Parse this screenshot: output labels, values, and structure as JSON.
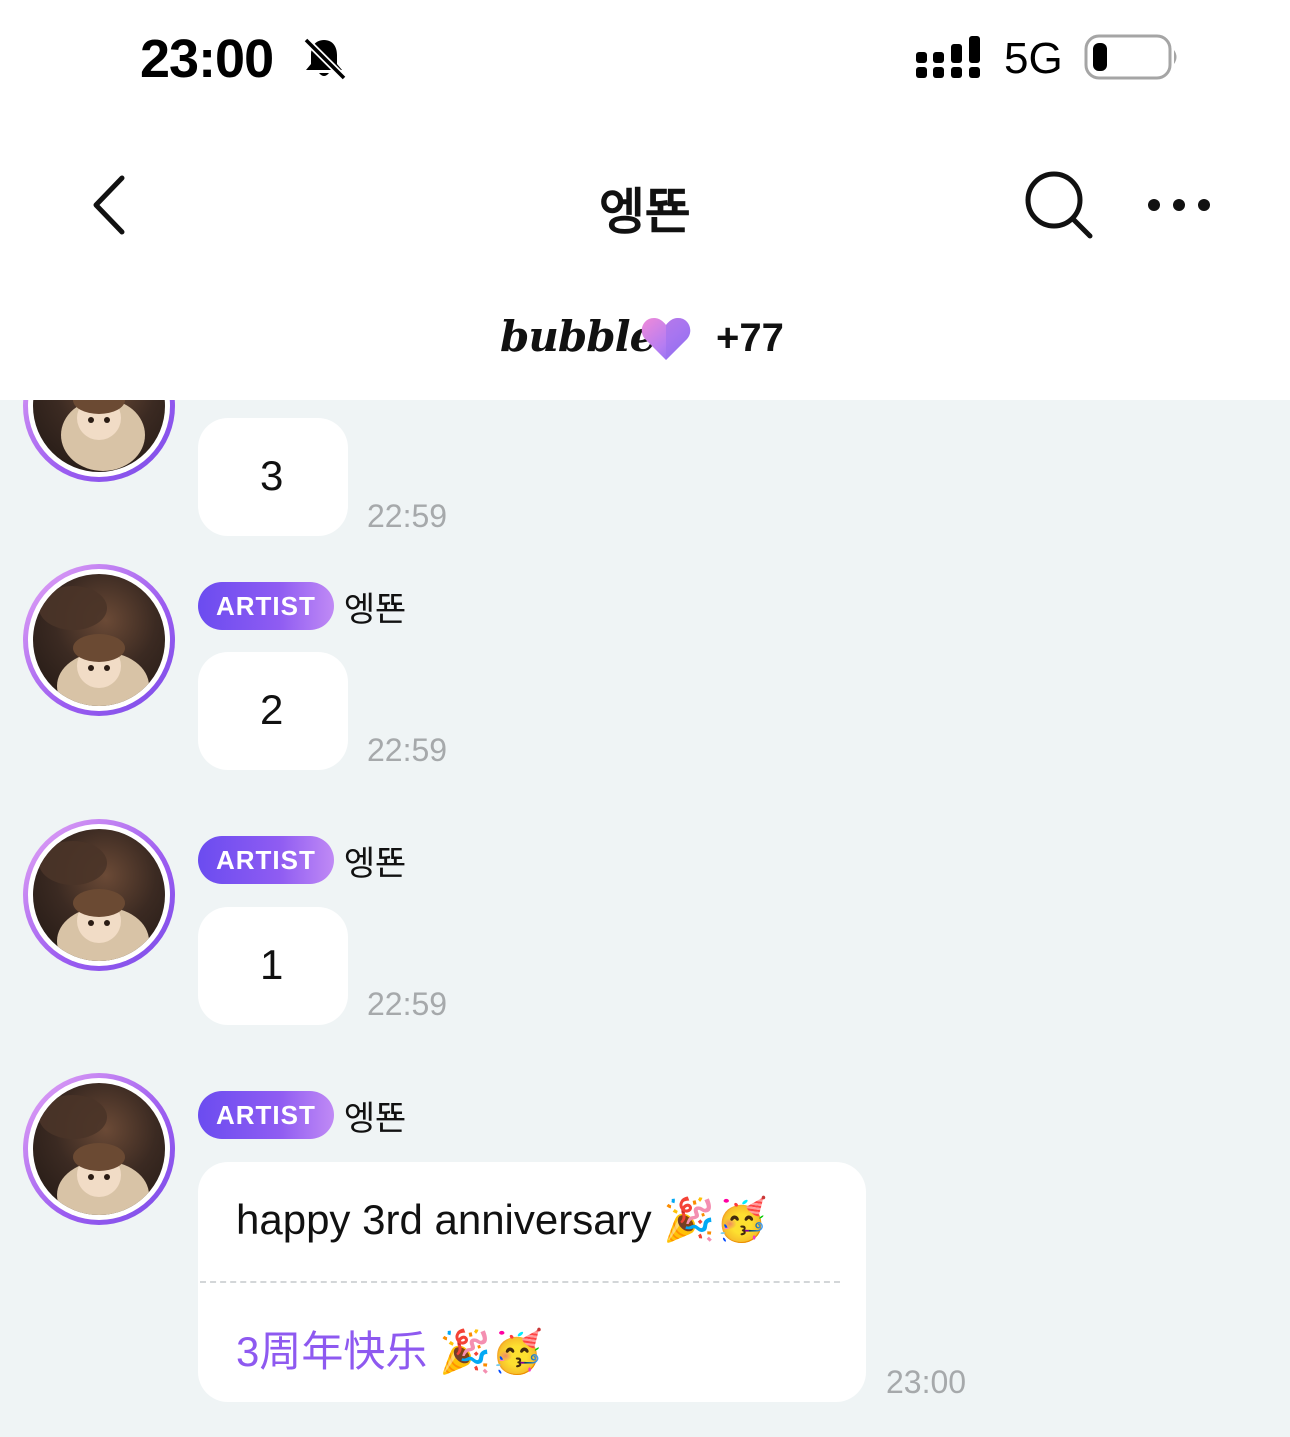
{
  "status_bar": {
    "time": "23:00",
    "network": "5G",
    "icons": [
      "bell-muted-icon",
      "signal-icon",
      "battery-icon"
    ]
  },
  "header": {
    "title": "엥뚄",
    "icons": [
      "back-icon",
      "search-icon",
      "more-icon"
    ]
  },
  "bubble_bar": {
    "logo": "bubble",
    "heart_icon": "heart-icon",
    "count": "+77"
  },
  "messages": [
    {
      "badge": "",
      "sender": "",
      "text": "3",
      "time": "22:59"
    },
    {
      "badge": "ARTIST",
      "sender": "엥뚄",
      "text": "2",
      "time": "22:59"
    },
    {
      "badge": "ARTIST",
      "sender": "엥뚄",
      "text": "1",
      "time": "22:59"
    },
    {
      "badge": "ARTIST",
      "sender": "엥뚄",
      "text": "happy 3rd anniversary 🎉🥳",
      "translation": "3周年快乐 🎉🥳",
      "time": "23:00"
    }
  ],
  "colors": {
    "chat_background": "#eff4f5",
    "badge_gradient_start": "#6b4cf0",
    "badge_gradient_end": "#c08af5",
    "translation_text": "#8e59f0",
    "timestamp": "#a6a9ab"
  }
}
